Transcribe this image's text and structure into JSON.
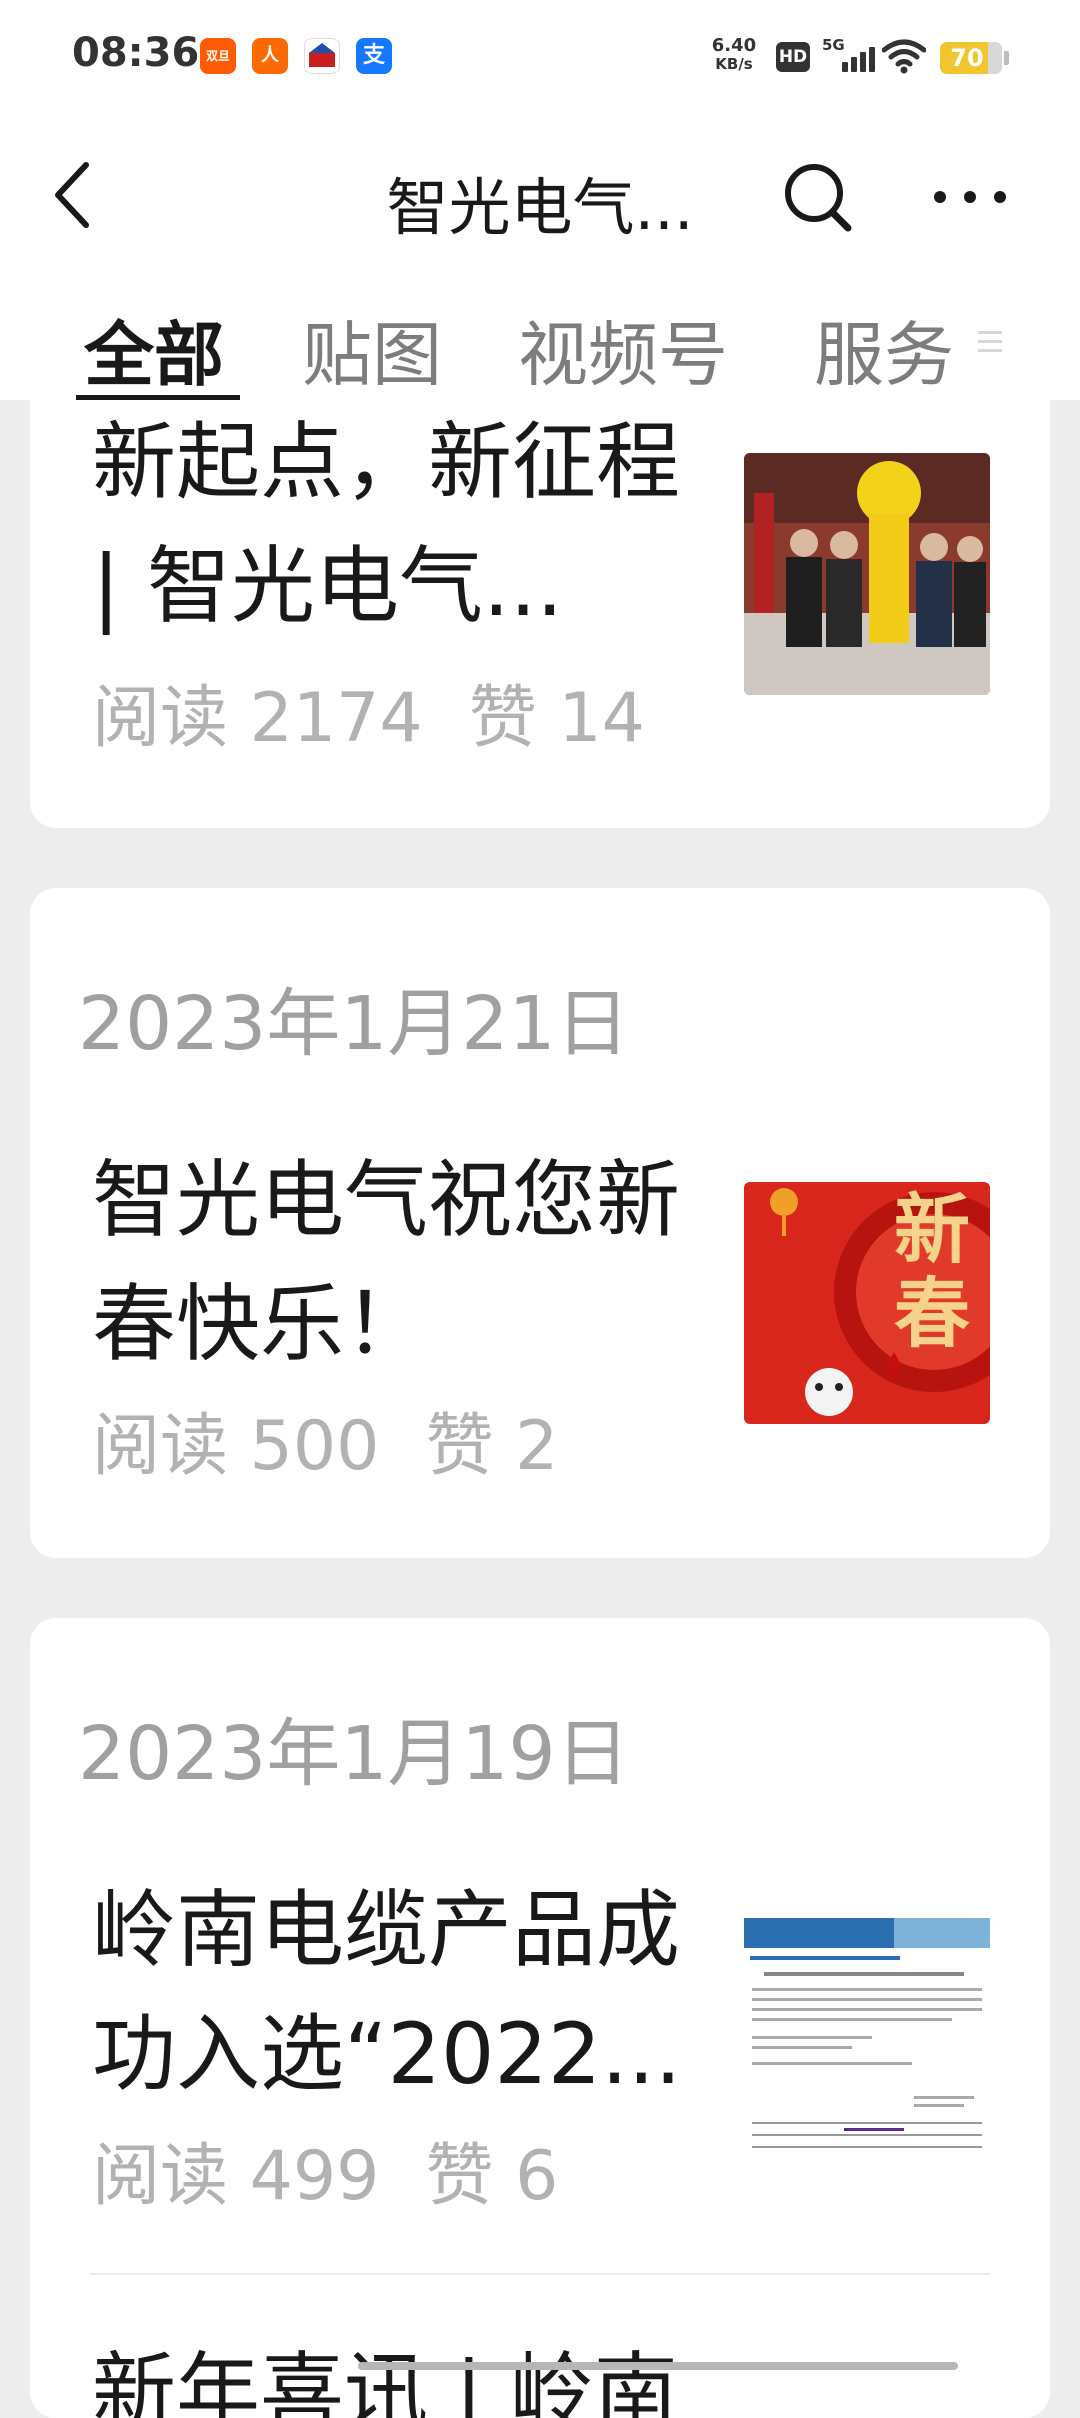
{
  "status_bar": {
    "time": "08:36",
    "apps": [
      {
        "name": "taobao-app-icon",
        "label": "双旦",
        "color": "#ff5a00"
      },
      {
        "name": "shopping-app-icon",
        "label": "人",
        "color": "#ff6a00"
      },
      {
        "name": "game-app-icon",
        "label": "",
        "color": "#c81e1e"
      },
      {
        "name": "alipay-app-icon",
        "label": "支",
        "color": "#1677ff"
      }
    ],
    "net_speed_value": "6.40",
    "net_speed_unit": "KB/s",
    "hd_label": "HD",
    "network_label": "5G",
    "battery": "70"
  },
  "nav": {
    "title": "智光电气...",
    "back_icon": "chevron-left-icon",
    "search_icon": "search-icon",
    "more_icon": "more-horizontal-icon"
  },
  "tabs": [
    {
      "label": "全部",
      "active": true
    },
    {
      "label": "贴图",
      "active": false
    },
    {
      "label": "视频号",
      "active": false
    },
    {
      "label": "服务",
      "active": false
    }
  ],
  "cards": [
    {
      "articles": [
        {
          "title": "新起点，新征程 | 智光电气...",
          "read_label": "阅读",
          "reads": "2174",
          "like_label": "赞",
          "likes": "14",
          "thumb": "lion-dance-photo"
        }
      ]
    },
    {
      "date": "2023年1月21日",
      "articles": [
        {
          "title": "智光电气祝您新春快乐！",
          "read_label": "阅读",
          "reads": "500",
          "like_label": "赞",
          "likes": "2",
          "thumb": "spring-festival-image",
          "thumb_text": "新春"
        }
      ]
    },
    {
      "date": "2023年1月19日",
      "articles": [
        {
          "title": "岭南电缆产品成功入选“2022...",
          "read_label": "阅读",
          "reads": "499",
          "like_label": "赞",
          "likes": "6",
          "thumb": "document-screenshot-image"
        },
        {
          "title": "新年喜讯 | 岭南"
        }
      ]
    }
  ]
}
